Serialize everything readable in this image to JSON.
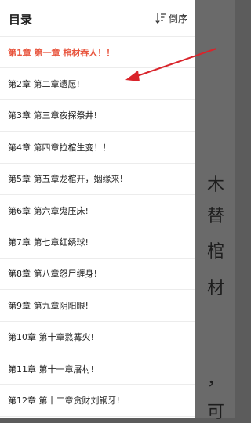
{
  "drawer": {
    "title": "目录",
    "sort_label": "倒序",
    "chapters": [
      {
        "label": "第1章 第一章 棺材吞人！！"
      },
      {
        "label": "第2章 第二章遗愿!"
      },
      {
        "label": "第3章 第三章夜探祭井!"
      },
      {
        "label": "第4章 第四章拉棺生变！！"
      },
      {
        "label": "第5章 第五章龙棺开，姻缘来!"
      },
      {
        "label": "第6章 第六章鬼压床!"
      },
      {
        "label": "第7章 第七章红绣球!"
      },
      {
        "label": "第8章 第八章怨尸缠身!"
      },
      {
        "label": "第9章 第九章阴阳眼!"
      },
      {
        "label": "第10章 第十章熬篝火!"
      },
      {
        "label": "第11章 第十一章屠村!"
      },
      {
        "label": "第12章 第十二章贪财刘钢牙!"
      }
    ],
    "active_color": "#e8553e"
  },
  "reader": {
    "chars": [
      "木",
      "替",
      "棺",
      "材",
      "，",
      "可"
    ]
  },
  "annotation": {
    "arrow_color": "#d9242b"
  }
}
